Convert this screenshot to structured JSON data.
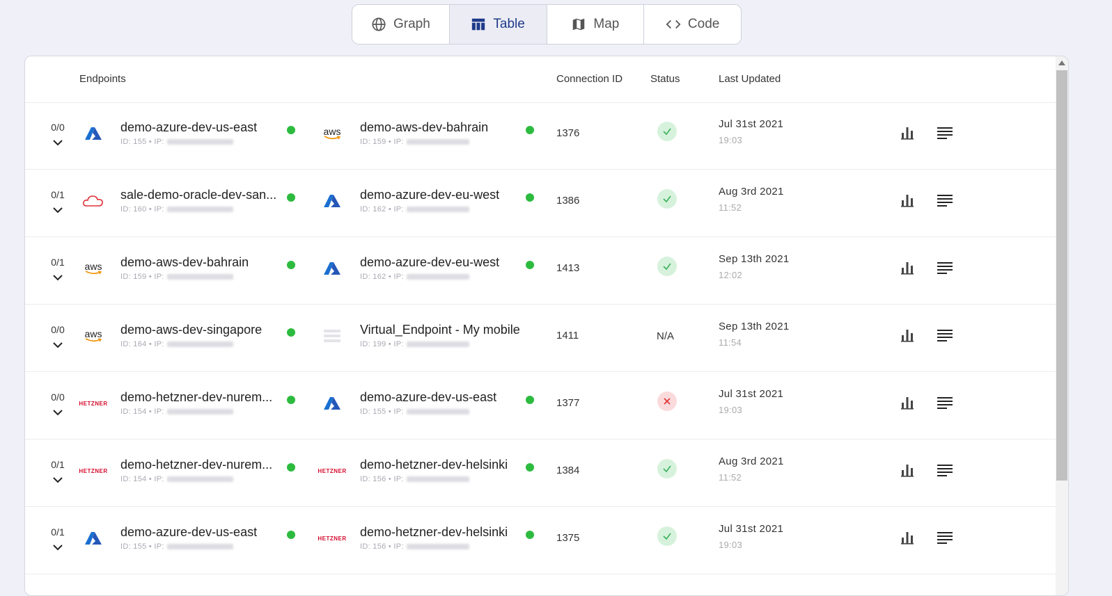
{
  "tabs": [
    {
      "label": "Graph",
      "icon": "globe-icon"
    },
    {
      "label": "Table",
      "icon": "table-icon"
    },
    {
      "label": "Map",
      "icon": "map-icon"
    },
    {
      "label": "Code",
      "icon": "code-icon"
    }
  ],
  "active_tab": "Table",
  "headers": {
    "endpoints": "Endpoints",
    "connection_id": "Connection ID",
    "status": "Status",
    "last_updated": "Last Updated"
  },
  "colors": {
    "accent": "#1f3a8a",
    "online": "#2dbb3f",
    "ok": "#d6f2dc",
    "fail": "#fbdadc"
  },
  "rows": [
    {
      "count": "0/0",
      "a": {
        "provider": "azure",
        "name": "demo-azure-dev-us-east",
        "sub": "ID: 155 • IP:"
      },
      "b": {
        "provider": "aws",
        "name": "demo-aws-dev-bahrain",
        "sub": "ID: 159 • IP:"
      },
      "connection_id": "1376",
      "status": "ok",
      "date": "Jul 31st 2021",
      "time": "19:03"
    },
    {
      "count": "0/1",
      "a": {
        "provider": "oracle",
        "name": "sale-demo-oracle-dev-san...",
        "sub": "ID: 160 • IP:"
      },
      "b": {
        "provider": "azure",
        "name": "demo-azure-dev-eu-west",
        "sub": "ID: 162 • IP:"
      },
      "connection_id": "1386",
      "status": "ok",
      "date": "Aug 3rd 2021",
      "time": "11:52"
    },
    {
      "count": "0/1",
      "a": {
        "provider": "aws",
        "name": "demo-aws-dev-bahrain",
        "sub": "ID: 159 • IP:"
      },
      "b": {
        "provider": "azure",
        "name": "demo-azure-dev-eu-west",
        "sub": "ID: 162 • IP:"
      },
      "connection_id": "1413",
      "status": "ok",
      "date": "Sep 13th 2021",
      "time": "12:02"
    },
    {
      "count": "0/0",
      "a": {
        "provider": "aws",
        "name": "demo-aws-dev-singapore",
        "sub": "ID: 164 • IP:"
      },
      "b": {
        "provider": "virtual",
        "name": "Virtual_Endpoint - My mobile",
        "sub": "ID: 199 • IP:"
      },
      "connection_id": "1411",
      "status": "na",
      "status_text": "N/A",
      "date": "Sep 13th 2021",
      "time": "11:54"
    },
    {
      "count": "0/0",
      "a": {
        "provider": "hetzner",
        "name": "demo-hetzner-dev-nurem...",
        "sub": "ID: 154 • IP:"
      },
      "b": {
        "provider": "azure",
        "name": "demo-azure-dev-us-east",
        "sub": "ID: 155 • IP:"
      },
      "connection_id": "1377",
      "status": "fail",
      "date": "Jul 31st 2021",
      "time": "19:03"
    },
    {
      "count": "0/1",
      "a": {
        "provider": "hetzner",
        "name": "demo-hetzner-dev-nurem...",
        "sub": "ID: 154 • IP:"
      },
      "b": {
        "provider": "hetzner",
        "name": "demo-hetzner-dev-helsinki",
        "sub": "ID: 156 • IP:"
      },
      "connection_id": "1384",
      "status": "ok",
      "date": "Aug 3rd 2021",
      "time": "11:52"
    },
    {
      "count": "0/1",
      "a": {
        "provider": "azure",
        "name": "demo-azure-dev-us-east",
        "sub": "ID: 155 • IP:"
      },
      "b": {
        "provider": "hetzner",
        "name": "demo-hetzner-dev-helsinki",
        "sub": "ID: 156 • IP:"
      },
      "connection_id": "1375",
      "status": "ok",
      "date": "Jul 31st 2021",
      "time": "19:03"
    }
  ]
}
